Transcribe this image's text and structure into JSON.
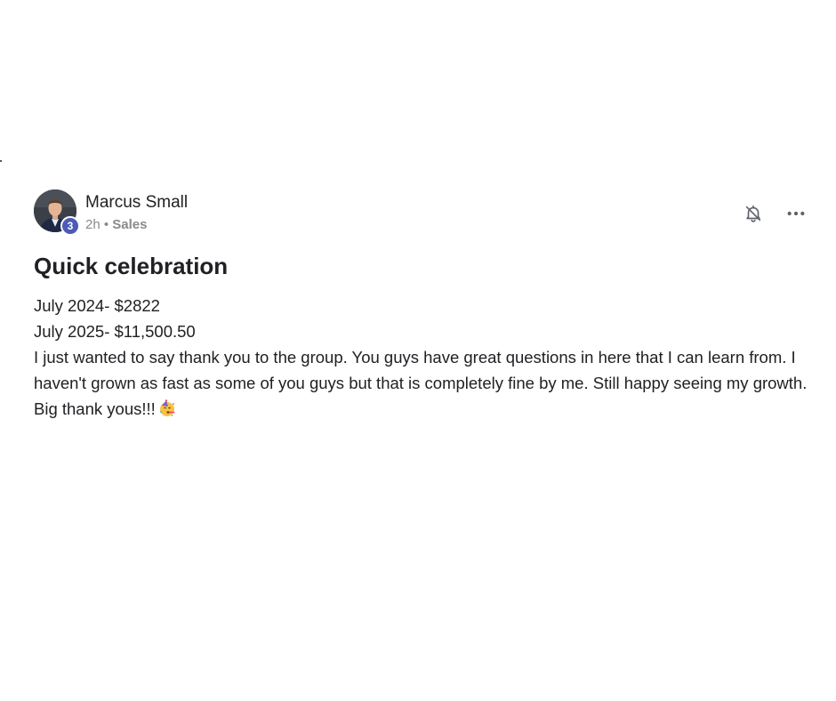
{
  "post": {
    "author": {
      "name": "Marcus Small",
      "level": "3"
    },
    "meta": {
      "time": "2h",
      "separator": "•",
      "category": "Sales"
    },
    "actions": {
      "notification_icon": "bell-off-icon",
      "more_icon": "more-horizontal-icon"
    },
    "title": "Quick celebration",
    "body": {
      "line1": "July 2024- $2822",
      "line2": "July 2025- $11,500.50",
      "paragraph": "I just wanted to say thank you to the group. You guys have great questions in here that I can learn from. I haven't grown as fast as some of you guys but that is completely fine by me. Still happy seeing my growth. Big thank yous!!!",
      "emoji": "partying-face-emoji"
    },
    "colors": {
      "level_badge": "#4d5bb5",
      "text": "#202124",
      "meta": "#8a8a8a"
    }
  }
}
